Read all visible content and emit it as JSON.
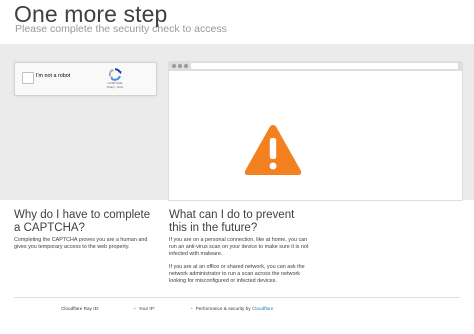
{
  "header": {
    "title": "One more step",
    "subtitle": "Please complete the security check to access"
  },
  "captcha": {
    "label": "I'm not a robot",
    "brand": "reCAPTCHA",
    "links": "Privacy - Terms",
    "logo_icon": "recaptcha-logo-icon"
  },
  "illustration": {
    "warning_icon": "warning-triangle-icon",
    "warning_color": "#f48120"
  },
  "why": {
    "heading": "Why do I have to complete a CAPTCHA?",
    "text": "Completing the CAPTCHA proves you are a human and gives you temporary access to the web property."
  },
  "prevent": {
    "heading": "What can I do to prevent this in the future?",
    "text1": "If you are on a personal connection, like at home, you can run an anti-virus scan on your device to make sure it is not infected with malware.",
    "text2": "If you are at an office or shared network, you can ask the network administrator to run a scan across the network looking for misconfigured or infected devices."
  },
  "footer": {
    "ray_id_label": "Cloudflare Ray ID:",
    "ip_label": "Your IP:",
    "performance_label": "Performance & security by",
    "performance_link": "Cloudflare",
    "separator": "•",
    "link_color": "#2c7cb0"
  }
}
